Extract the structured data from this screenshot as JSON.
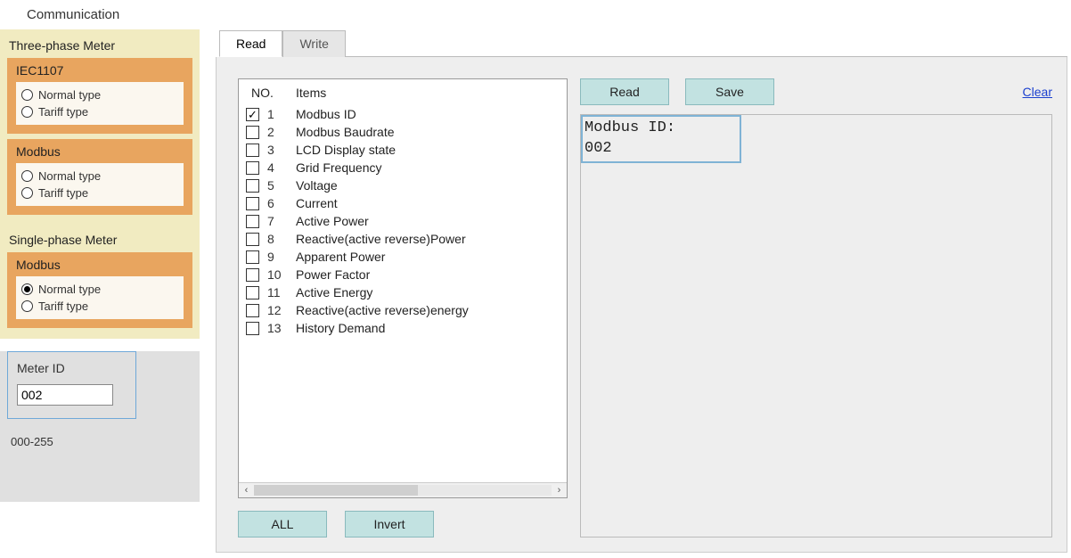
{
  "page_title": "Communication",
  "sidebar": {
    "three_phase": {
      "label": "Three-phase Meter",
      "iec1107": {
        "label": "IEC1107",
        "options": [
          {
            "label": "Normal type",
            "selected": false
          },
          {
            "label": "Tariff type",
            "selected": false
          }
        ]
      },
      "modbus": {
        "label": "Modbus",
        "options": [
          {
            "label": "Normal type",
            "selected": false
          },
          {
            "label": "Tariff type",
            "selected": false
          }
        ]
      }
    },
    "single_phase": {
      "label": "Single-phase Meter",
      "modbus": {
        "label": "Modbus",
        "options": [
          {
            "label": "Normal type",
            "selected": true
          },
          {
            "label": "Tariff type",
            "selected": false
          }
        ]
      }
    },
    "meter_id": {
      "label": "Meter ID",
      "value": "002",
      "range": "000-255"
    }
  },
  "tabs": {
    "read": "Read",
    "write": "Write",
    "active": "read"
  },
  "list": {
    "col_no": "NO.",
    "col_items": "Items",
    "items": [
      {
        "n": "1",
        "label": "Modbus ID",
        "checked": true
      },
      {
        "n": "2",
        "label": "Modbus Baudrate",
        "checked": false
      },
      {
        "n": "3",
        "label": "LCD Display state",
        "checked": false
      },
      {
        "n": "4",
        "label": "Grid Frequency",
        "checked": false
      },
      {
        "n": "5",
        "label": "Voltage",
        "checked": false
      },
      {
        "n": "6",
        "label": "Current",
        "checked": false
      },
      {
        "n": "7",
        "label": "Active Power",
        "checked": false
      },
      {
        "n": "8",
        "label": "Reactive(active reverse)Power",
        "checked": false
      },
      {
        "n": "9",
        "label": "Apparent Power",
        "checked": false
      },
      {
        "n": "10",
        "label": "Power Factor",
        "checked": false
      },
      {
        "n": "11",
        "label": "Active Energy",
        "checked": false
      },
      {
        "n": "12",
        "label": "Reactive(active reverse)energy",
        "checked": false
      },
      {
        "n": "13",
        "label": "History Demand",
        "checked": false
      }
    ],
    "buttons": {
      "all": "ALL",
      "invert": "Invert"
    }
  },
  "actions": {
    "read": "Read",
    "save": "Save",
    "clear": "Clear"
  },
  "result": {
    "text": "Modbus ID:\n002"
  }
}
